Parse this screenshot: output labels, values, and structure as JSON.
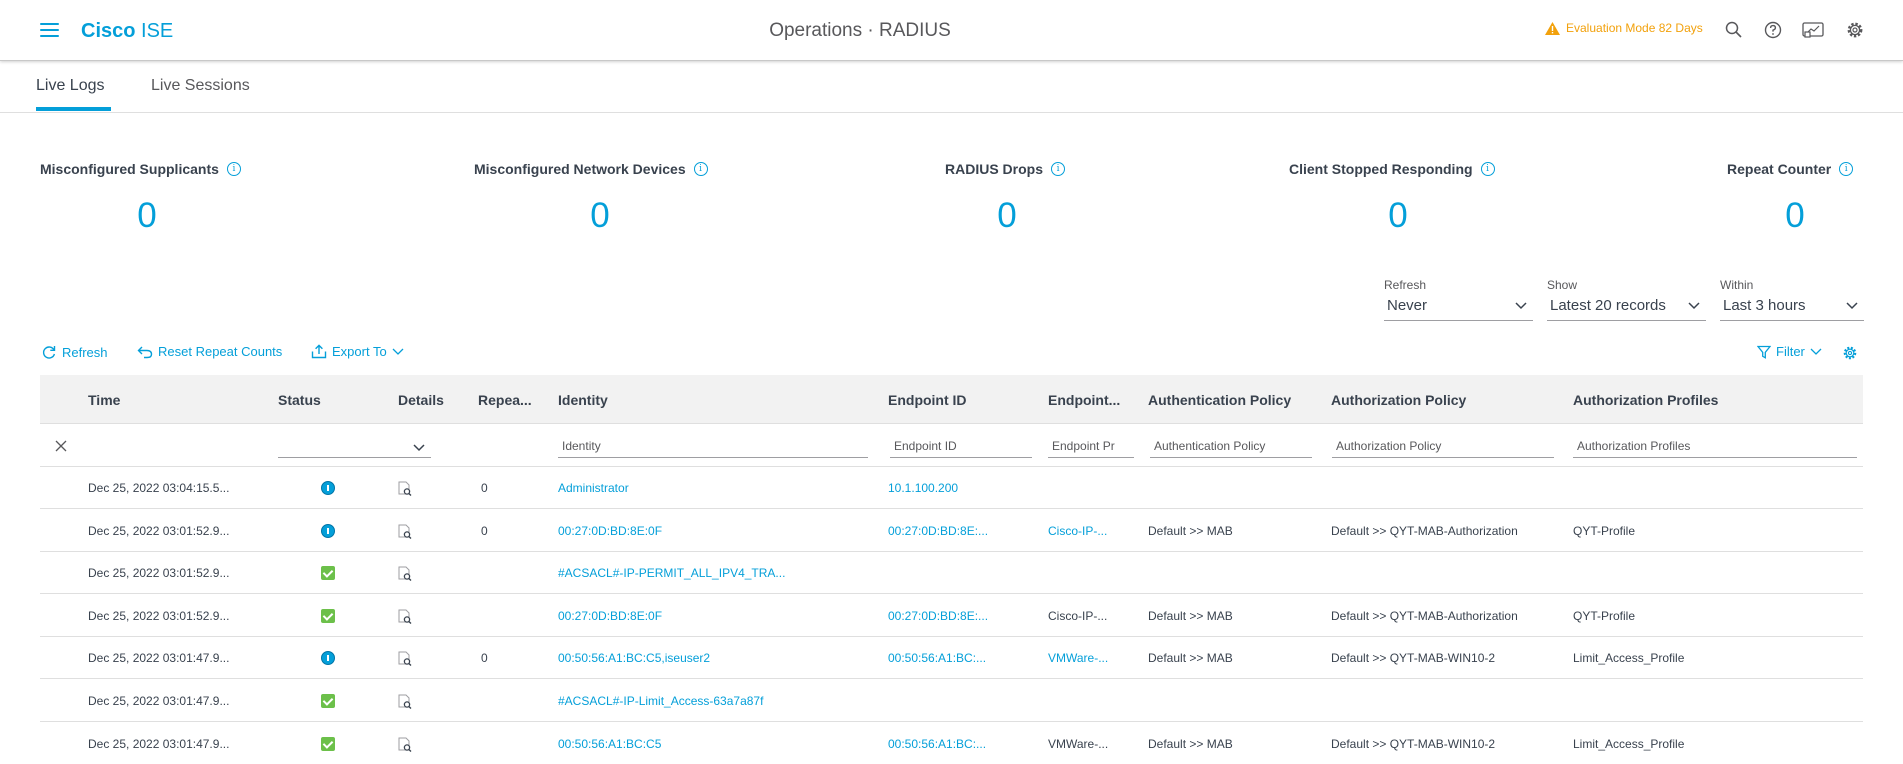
{
  "header": {
    "brand_bold": "Cisco",
    "brand_light": "ISE",
    "title": "Operations · RADIUS",
    "eval_mode": "Evaluation Mode 82 Days",
    "icons": [
      "search-icon",
      "help-icon",
      "dashboard-icon",
      "settings-icon"
    ]
  },
  "tabs": [
    {
      "label": "Live Logs",
      "active": true
    },
    {
      "label": "Live Sessions",
      "active": false
    }
  ],
  "counters": [
    {
      "label": "Misconfigured Supplicants",
      "value": "0"
    },
    {
      "label": "Misconfigured Network Devices",
      "value": "0"
    },
    {
      "label": "RADIUS Drops",
      "value": "0"
    },
    {
      "label": "Client Stopped Responding",
      "value": "0"
    },
    {
      "label": "Repeat Counter",
      "value": "0"
    }
  ],
  "selects": {
    "refresh": {
      "label": "Refresh",
      "value": "Never"
    },
    "show": {
      "label": "Show",
      "value": "Latest 20 records"
    },
    "within": {
      "label": "Within",
      "value": "Last 3 hours"
    }
  },
  "toolbar": {
    "refresh": "Refresh",
    "reset": "Reset Repeat Counts",
    "export": "Export To",
    "filter": "Filter"
  },
  "columns": {
    "time": "Time",
    "status": "Status",
    "details": "Details",
    "repeat": "Repea...",
    "identity": "Identity",
    "endpoint_id": "Endpoint ID",
    "endpoint_profile": "Endpoint...",
    "authn_policy": "Authentication Policy",
    "authz_policy": "Authorization Policy",
    "authz_profiles": "Authorization Profiles"
  },
  "filters": {
    "identity": "Identity",
    "endpoint_id": "Endpoint ID",
    "endpoint_profile": "Endpoint Pr",
    "authn_policy": "Authentication Policy",
    "authz_policy": "Authorization Policy",
    "authz_profiles": "Authorization Profiles"
  },
  "rows": [
    {
      "time": "Dec 25, 2022 03:04:15.5...",
      "status": "info",
      "repeat": "0",
      "identity": "Administrator",
      "endpoint_id": "10.1.100.200",
      "profile": "",
      "profile_link": false,
      "authn": "",
      "authz": "",
      "authz_profile": ""
    },
    {
      "time": "Dec 25, 2022 03:01:52.9...",
      "status": "info",
      "repeat": "0",
      "identity": "00:27:0D:BD:8E:0F",
      "endpoint_id": "00:27:0D:BD:8E:...",
      "profile": "Cisco-IP-...",
      "profile_link": true,
      "authn": "Default >> MAB",
      "authz": "Default >> QYT-MAB-Authorization",
      "authz_profile": "QYT-Profile"
    },
    {
      "time": "Dec 25, 2022 03:01:52.9...",
      "status": "ok",
      "repeat": "",
      "identity": "#ACSACL#-IP-PERMIT_ALL_IPV4_TRA...",
      "endpoint_id": "",
      "profile": "",
      "profile_link": false,
      "authn": "",
      "authz": "",
      "authz_profile": ""
    },
    {
      "time": "Dec 25, 2022 03:01:52.9...",
      "status": "ok",
      "repeat": "",
      "identity": "00:27:0D:BD:8E:0F",
      "endpoint_id": "00:27:0D:BD:8E:...",
      "profile": "Cisco-IP-...",
      "profile_link": false,
      "authn": "Default >> MAB",
      "authz": "Default >> QYT-MAB-Authorization",
      "authz_profile": "QYT-Profile"
    },
    {
      "time": "Dec 25, 2022 03:01:47.9...",
      "status": "info",
      "repeat": "0",
      "identity": "00:50:56:A1:BC:C5,iseuser2",
      "endpoint_id": "00:50:56:A1:BC:...",
      "profile": "VMWare-...",
      "profile_link": true,
      "authn": "Default >> MAB",
      "authz": "Default >> QYT-MAB-WIN10-2",
      "authz_profile": "Limit_Access_Profile"
    },
    {
      "time": "Dec 25, 2022 03:01:47.9...",
      "status": "ok",
      "repeat": "",
      "identity": "#ACSACL#-IP-Limit_Access-63a7a87f",
      "endpoint_id": "",
      "profile": "",
      "profile_link": false,
      "authn": "",
      "authz": "",
      "authz_profile": ""
    },
    {
      "time": "Dec 25, 2022 03:01:47.9...",
      "status": "ok",
      "repeat": "",
      "identity": "00:50:56:A1:BC:C5",
      "endpoint_id": "00:50:56:A1:BC:...",
      "profile": "VMWare-...",
      "profile_link": false,
      "authn": "Default >> MAB",
      "authz": "Default >> QYT-MAB-WIN10-2",
      "authz_profile": "Limit_Access_Profile"
    }
  ],
  "colors": {
    "accent": "#049fd9",
    "warning": "#f2a10c",
    "success": "#6cc04a"
  }
}
